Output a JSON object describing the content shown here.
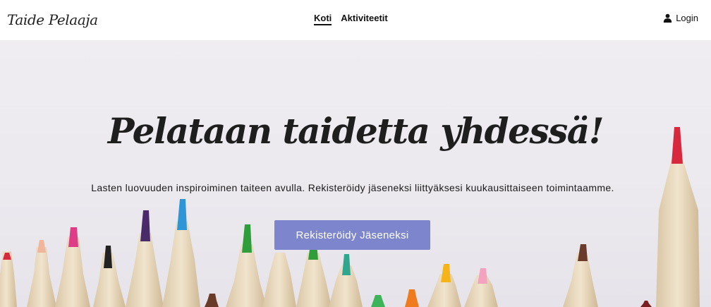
{
  "navbar": {
    "brand": "Taide Pelaaja",
    "links": [
      {
        "label": "Koti",
        "active": true
      },
      {
        "label": "Aktiviteetit",
        "active": false
      }
    ],
    "login_label": "Login",
    "login_icon": "user-icon"
  },
  "hero": {
    "title": "Pelataan taidetta yhdessä!",
    "subtitle": "Lasten luovuuden inspiroiminen taiteen avulla. Rekisteröidy jäseneksi liittyäksesi kuukausittaiseen toimintaamme.",
    "cta_label": "Rekisteröidy Jäseneksi",
    "background_image": "colored-pencils"
  },
  "colors": {
    "accent_button": "#7d86cc",
    "hero_background": "#eceaef",
    "text": "#1e1e1e"
  }
}
